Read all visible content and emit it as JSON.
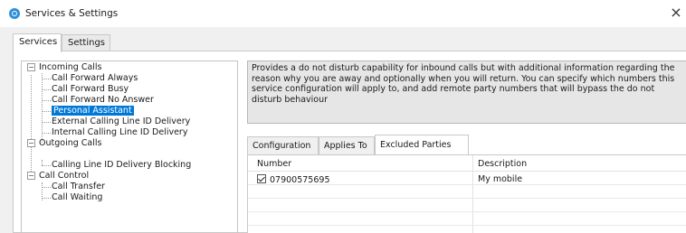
{
  "window": {
    "title": "Services & Settings",
    "close_label": "×"
  },
  "tabs": [
    {
      "label": "Services",
      "active": true
    },
    {
      "label": "Settings",
      "active": false
    }
  ],
  "tree": {
    "expand_symbol": "−",
    "groups": [
      {
        "label": "Incoming Calls",
        "items": [
          {
            "label": "Call Forward Always"
          },
          {
            "label": "Call Forward Busy"
          },
          {
            "label": "Call Forward No Answer"
          },
          {
            "label": "Personal Assistant",
            "selected": true
          },
          {
            "label": "External Calling Line ID Delivery"
          },
          {
            "label": "Internal Calling Line ID Delivery"
          }
        ]
      },
      {
        "label": "Outgoing Calls",
        "items": [
          {
            "label": "Calling Line ID Delivery Blocking"
          }
        ]
      },
      {
        "label": "Call Control",
        "items": [
          {
            "label": "Call Transfer"
          },
          {
            "label": "Call Waiting"
          }
        ]
      }
    ]
  },
  "description": "Provides a do not disturb capability for inbound calls but with additional information regarding the reason why you are away and optionally when you will return. You can specify which numbers this service configuration will apply to, and add remote party numbers that will bypass the do not disturb behaviour",
  "subtabs": [
    {
      "label": "Configuration",
      "active": false
    },
    {
      "label": "Applies To",
      "active": false
    },
    {
      "label": "Excluded Parties",
      "active": true
    }
  ],
  "excluded_parties": {
    "columns": [
      "Number",
      "Description"
    ],
    "rows": [
      {
        "number": "07900575695",
        "description": "My mobile",
        "checked": true
      }
    ]
  }
}
